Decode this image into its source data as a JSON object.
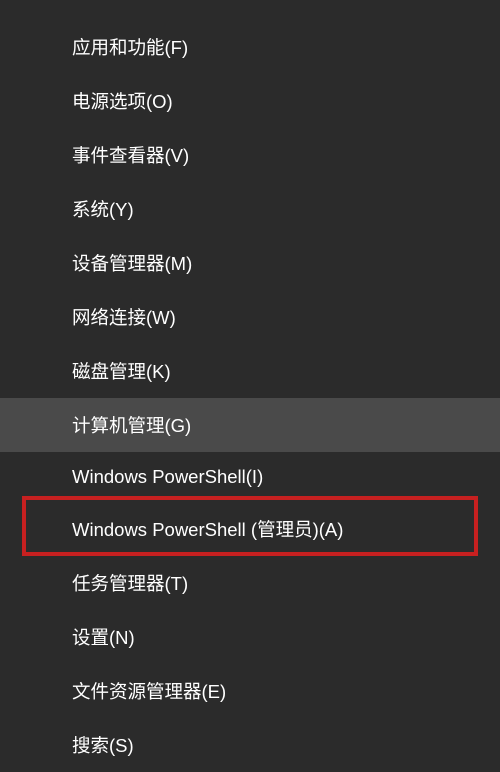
{
  "menu": {
    "items": [
      {
        "label": "应用和功能(F)",
        "hovered": false,
        "highlighted": false
      },
      {
        "label": "电源选项(O)",
        "hovered": false,
        "highlighted": false
      },
      {
        "label": "事件查看器(V)",
        "hovered": false,
        "highlighted": false
      },
      {
        "label": "系统(Y)",
        "hovered": false,
        "highlighted": false
      },
      {
        "label": "设备管理器(M)",
        "hovered": false,
        "highlighted": false
      },
      {
        "label": "网络连接(W)",
        "hovered": false,
        "highlighted": false
      },
      {
        "label": "磁盘管理(K)",
        "hovered": false,
        "highlighted": false
      },
      {
        "label": "计算机管理(G)",
        "hovered": true,
        "highlighted": false
      },
      {
        "label": "Windows PowerShell(I)",
        "hovered": false,
        "highlighted": false
      },
      {
        "label": "Windows PowerShell (管理员)(A)",
        "hovered": false,
        "highlighted": true
      },
      {
        "label": "任务管理器(T)",
        "hovered": false,
        "highlighted": false
      },
      {
        "label": "设置(N)",
        "hovered": false,
        "highlighted": false
      },
      {
        "label": "文件资源管理器(E)",
        "hovered": false,
        "highlighted": false
      },
      {
        "label": "搜索(S)",
        "hovered": false,
        "highlighted": false
      }
    ]
  },
  "colors": {
    "highlight_border": "#c72020",
    "menu_bg": "#2b2b2b",
    "hover_bg": "#4a4a4a"
  }
}
